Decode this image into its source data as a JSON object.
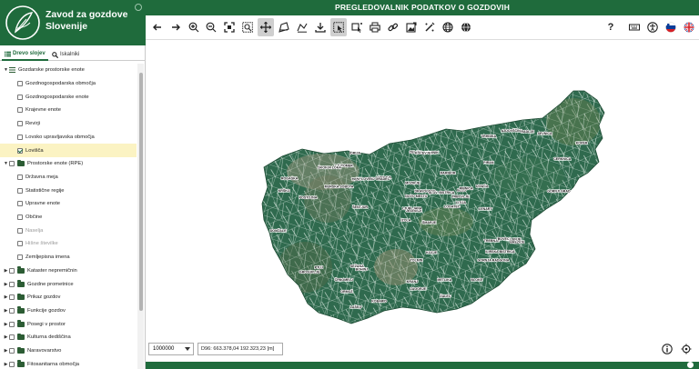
{
  "brand": {
    "title_line1": "Zavod za gozdove",
    "title_line2": "Slovenije"
  },
  "app_title": "PREGLEDOVALNIK PODATKOV O GOZDOVIH",
  "tabs": [
    {
      "label": "Drevo slojev",
      "icon": "list-icon"
    },
    {
      "label": "Iskalniki",
      "icon": "search-icon"
    }
  ],
  "tree": [
    {
      "label": "Gozdarske prostorske enote",
      "level": 0,
      "expanded": true,
      "checkbox": false,
      "kind": "lines"
    },
    {
      "label": "Gozdnogospodarska območja",
      "level": 1,
      "checked": false
    },
    {
      "label": "Gozdnogospodarske enote",
      "level": 1,
      "checked": false
    },
    {
      "label": "Krajevne enote",
      "level": 1,
      "checked": false
    },
    {
      "label": "Revirji",
      "level": 1,
      "checked": false
    },
    {
      "label": "Lovsko upravljavska območja",
      "level": 1,
      "checked": false
    },
    {
      "label": "Lovišča",
      "level": 1,
      "checked": true,
      "selected": true
    },
    {
      "label": "Prostorske enote (RPE)",
      "level": 0,
      "expanded": true,
      "checkbox": true,
      "kind": "folder"
    },
    {
      "label": "Državna meja",
      "level": 1,
      "checked": false
    },
    {
      "label": "Statistične regije",
      "level": 1,
      "checked": false
    },
    {
      "label": "Upravne enote",
      "level": 1,
      "checked": false
    },
    {
      "label": "Občine",
      "level": 1,
      "checked": false
    },
    {
      "label": "Naselja",
      "level": 1,
      "checked": false,
      "disabled": true
    },
    {
      "label": "Hišne številke",
      "level": 1,
      "checked": false,
      "disabled": true
    },
    {
      "label": "Zemljepisna imena",
      "level": 1,
      "checked": false
    },
    {
      "label": "Kataster nepremičnin",
      "level": 0,
      "expanded": false,
      "checkbox": true,
      "kind": "folder"
    },
    {
      "label": "Gozdne prometnice",
      "level": 0,
      "expanded": false,
      "checkbox": true,
      "kind": "folder"
    },
    {
      "label": "Prikaz gozdov",
      "level": 0,
      "expanded": false,
      "checkbox": true,
      "kind": "folder"
    },
    {
      "label": "Funkcije gozdov",
      "level": 0,
      "expanded": false,
      "checkbox": true,
      "kind": "folder"
    },
    {
      "label": "Posegi v prostor",
      "level": 0,
      "expanded": false,
      "checkbox": true,
      "kind": "folder"
    },
    {
      "label": "Kulturna dediščina",
      "level": 0,
      "expanded": false,
      "checkbox": true,
      "kind": "folder"
    },
    {
      "label": "Naravovarstvo",
      "level": 0,
      "expanded": false,
      "checkbox": true,
      "kind": "folder"
    },
    {
      "label": "Fitosanitarna območja",
      "level": 0,
      "expanded": false,
      "checkbox": true,
      "kind": "folder"
    }
  ],
  "toolbar": {
    "left": [
      {
        "name": "back-icon"
      },
      {
        "name": "forward-icon"
      },
      {
        "name": "zoom-in-icon"
      },
      {
        "name": "zoom-out-icon"
      },
      {
        "name": "full-extent-icon"
      },
      {
        "name": "zoom-box-icon"
      },
      {
        "name": "pan-icon",
        "active": true
      },
      {
        "name": "measure-area-icon"
      },
      {
        "name": "measure-length-icon"
      },
      {
        "name": "download-icon"
      },
      {
        "name": "select-box-icon",
        "active": true
      },
      {
        "name": "identify-icon"
      },
      {
        "name": "print-icon"
      },
      {
        "name": "link-icon"
      },
      {
        "name": "export-image-icon"
      },
      {
        "name": "draw-icon"
      },
      {
        "name": "globe-icon"
      },
      {
        "name": "globe-grid-icon"
      }
    ],
    "help_label": "?",
    "right": [
      {
        "name": "keyboard-icon"
      },
      {
        "name": "accessibility-icon"
      },
      {
        "name": "slovenian-flag-icon"
      },
      {
        "name": "english-flag-icon"
      }
    ]
  },
  "map": {
    "scale": "1000000",
    "coordinates": "D96: 663.378,04 192.323,23 [m]",
    "labels": [
      "ŠMARJE",
      "JESENICE",
      "BLED",
      "BOHINJ",
      "KAMNIK",
      "VRHNIKA",
      "LOGATEC",
      "POSTOJNA",
      "KOPER",
      "IZOLA",
      "PIRAN",
      "CELJE",
      "MARIBOR",
      "PTUJ",
      "LENDAVA",
      "ORMOŽ",
      "KOČEVJE",
      "RIBNICA",
      "BREŽICE",
      "KRŠKO",
      "TREBNJE",
      "LJUBLJANA",
      "KRANJ",
      "NOVO MESTO",
      "IDRIJA",
      "AJDOVŠČINA",
      "SEŽANA",
      "VELENJE",
      "SLOVENJ GRADEC",
      "MURSKA SOBOTA",
      "GORNJA RADGONA",
      "LAŠKO",
      "TRBOVLJE",
      "ZAGORJE",
      "LITIJA",
      "GROSUPLJE",
      "CERKNICA",
      "ILIRSKA BISTRICA",
      "ČRNOMELJ",
      "METLIKA",
      "SEVNICA",
      "ŠENTJUR",
      "ROGAŠKA",
      "LJUTOMER",
      "RADLJE",
      "DRAVOGRAD",
      "TOLMIN",
      "KOBARID",
      "BOVEC",
      "TRŽIČ",
      "ŠKOFJA LOKA",
      "DOMŽALE",
      "MOZIRJE",
      "ŽALEC",
      "SLOV. BISTRICA",
      "LENART",
      "GORNJI GRAD",
      "KOZJE",
      "BLOKE",
      "DIVAČA"
    ]
  },
  "colors": {
    "brand": "#1f6b3c",
    "selected_row": "#fbf3c3",
    "map_polygon": "#2f6a4e",
    "map_border": "#e8f2ec"
  }
}
